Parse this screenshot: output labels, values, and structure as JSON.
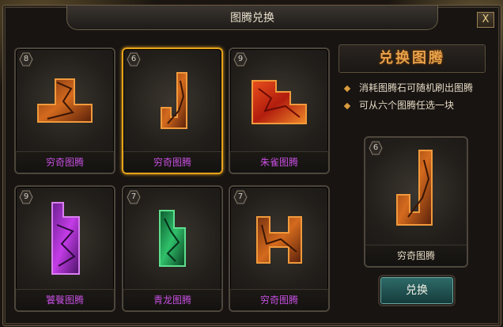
{
  "window": {
    "title": "图腾兑换",
    "close_label": "X"
  },
  "totems": [
    {
      "level": "8",
      "name": "穷奇图腾",
      "name_color": "#c64fe0",
      "color": "#c4621f",
      "shape": "inverted-t",
      "selected": false
    },
    {
      "level": "6",
      "name": "穷奇图腾",
      "name_color": "#c64fe0",
      "color": "#c4621f",
      "shape": "j",
      "selected": true
    },
    {
      "level": "9",
      "name": "朱雀图腾",
      "name_color": "#c64fe0",
      "color": "#d1331a",
      "shape": "steps",
      "selected": false
    },
    {
      "level": "9",
      "name": "饕餮图腾",
      "name_color": "#c64fe0",
      "color": "#a335d6",
      "shape": "l-tall",
      "selected": false
    },
    {
      "level": "7",
      "name": "青龙图腾",
      "name_color": "#c64fe0",
      "color": "#1e9a52",
      "shape": "l-green",
      "selected": false
    },
    {
      "level": "7",
      "name": "穷奇图腾",
      "name_color": "#c64fe0",
      "color": "#c4621f",
      "shape": "h",
      "selected": false
    }
  ],
  "panel": {
    "title": "兑换图腾",
    "bullets": [
      "消耗图腾石可随机刷出图腾",
      "可从六个图腾任选一块"
    ]
  },
  "preview": {
    "level": "6",
    "name": "穷奇图腾",
    "shape": "j",
    "color": "#c4621f"
  },
  "exchange_button": "兑换"
}
